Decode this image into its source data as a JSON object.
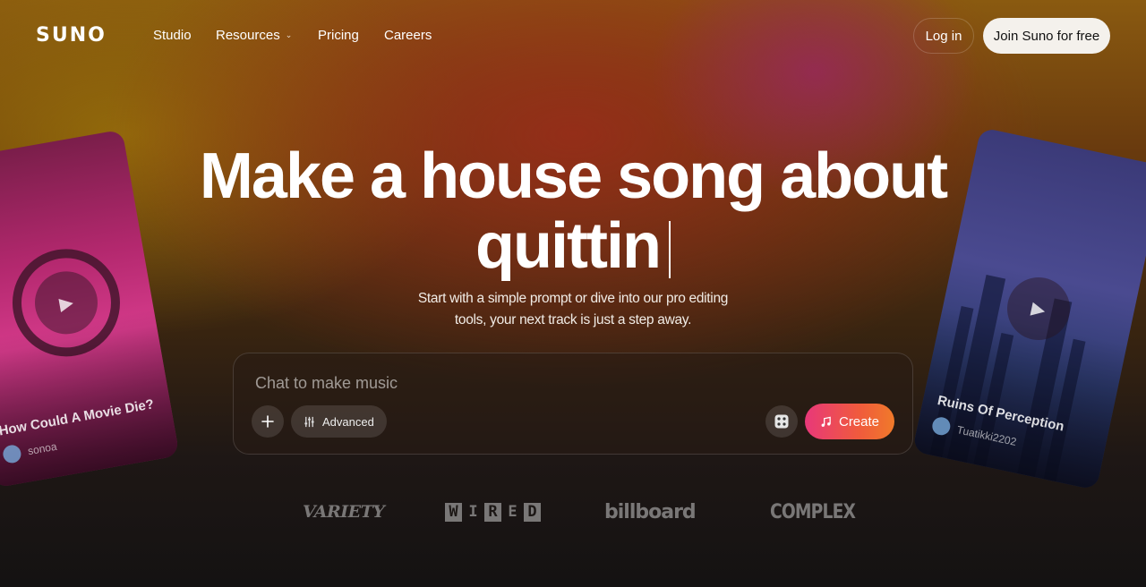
{
  "brand": {
    "logo": "SUNO"
  },
  "nav": {
    "links": [
      {
        "label": "Studio"
      },
      {
        "label": "Resources",
        "has_dropdown": true
      },
      {
        "label": "Pricing"
      },
      {
        "label": "Careers"
      }
    ],
    "login_label": "Log in",
    "join_label": "Join Suno for free"
  },
  "hero": {
    "headline_line1": "Make a house song about",
    "headline_line2": "quittin",
    "subtitle_line1": "Start with a simple prompt or dive into our pro editing",
    "subtitle_line2": "tools, your next track is just a step away."
  },
  "prompt": {
    "placeholder": "Chat to make music",
    "value": "",
    "add_icon": "plus-icon",
    "advanced_label": "Advanced",
    "advanced_icon": "sliders-icon",
    "random_icon": "dice-icon",
    "create_label": "Create",
    "create_icon": "music-note-icon"
  },
  "cards": [
    {
      "title": "How Could A Movie Die?",
      "user": "sonoa",
      "icon": "play-icon"
    },
    {
      "title": "Ruins Of Perception",
      "user": "Tuatikki2202",
      "icon": "play-icon"
    }
  ],
  "press": {
    "logos": [
      "VARIETY",
      "WIRED",
      "billboard",
      "COMPLEX"
    ]
  },
  "colors": {
    "create_gradient_start": "#e8387a",
    "create_gradient_end": "#f07a2a",
    "join_bg": "#f4f1ec"
  }
}
